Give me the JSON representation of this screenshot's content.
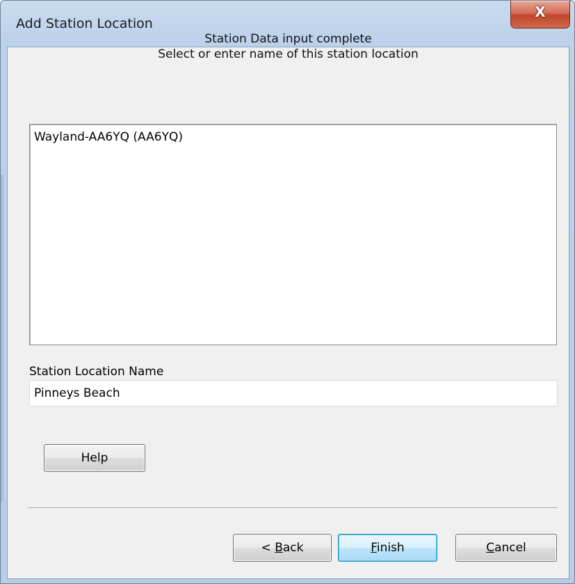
{
  "window": {
    "title": "Add Station Location",
    "close_glyph": "X"
  },
  "header": {
    "line1": "Station Data input complete",
    "line2": "Select or enter name of this station location"
  },
  "station_list": {
    "items": [
      "Wayland-AA6YQ (AA6YQ)"
    ]
  },
  "location_field": {
    "label": "Station Location Name",
    "value": "Pinneys Beach"
  },
  "buttons": {
    "help": "Help",
    "back_prefix": "< ",
    "back_mnemonic": "B",
    "back_rest": "ack",
    "finish_mnemonic": "F",
    "finish_rest": "inish",
    "cancel_mnemonic": "C",
    "cancel_rest": "ancel"
  },
  "colors": {
    "close_button": "#c0452b",
    "default_button_border": "#3c7fb1",
    "frame": "#bcd1ea"
  },
  "icons": {
    "close": "close-icon"
  }
}
